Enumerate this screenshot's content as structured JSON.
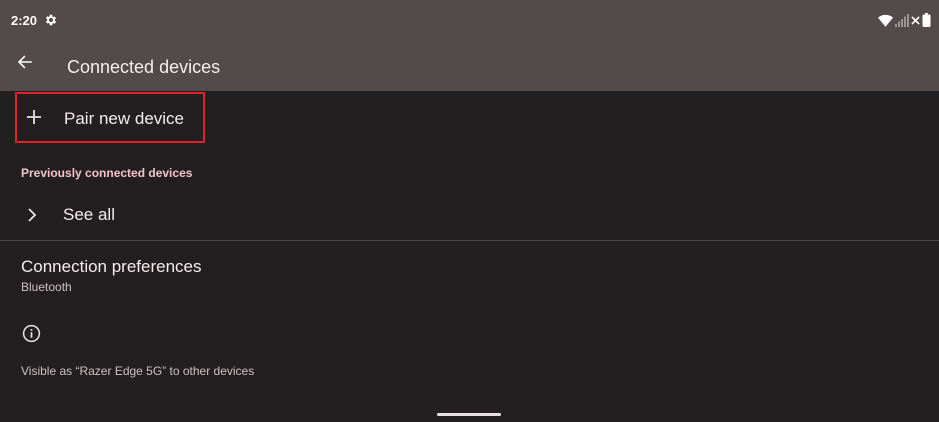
{
  "status_bar": {
    "time": "2:20",
    "left_icons": [
      "gear-icon"
    ],
    "right_icons": [
      "wifi-icon",
      "signal-icon",
      "no-signal-x-icon",
      "battery-icon"
    ]
  },
  "app_bar": {
    "back_icon": "arrow-back-icon",
    "title": "Connected devices"
  },
  "pair_new_device": {
    "icon": "plus-icon",
    "label": "Pair new device",
    "highlight_color": "#e4202a"
  },
  "previously_connected": {
    "header": "Previously connected devices",
    "see_all": {
      "icon": "chevron-right-icon",
      "label": "See all"
    }
  },
  "connection_preferences": {
    "title": "Connection preferences",
    "summary": "Bluetooth"
  },
  "footer": {
    "icon": "info-icon",
    "text": "Visible as “Razer Edge 5G” to other devices"
  },
  "colors": {
    "background": "#231f20",
    "app_bar": "#534b4a",
    "accent_header": "#f2c4cb",
    "primary_text": "#f3eded",
    "secondary_text": "#cbc3c3"
  }
}
